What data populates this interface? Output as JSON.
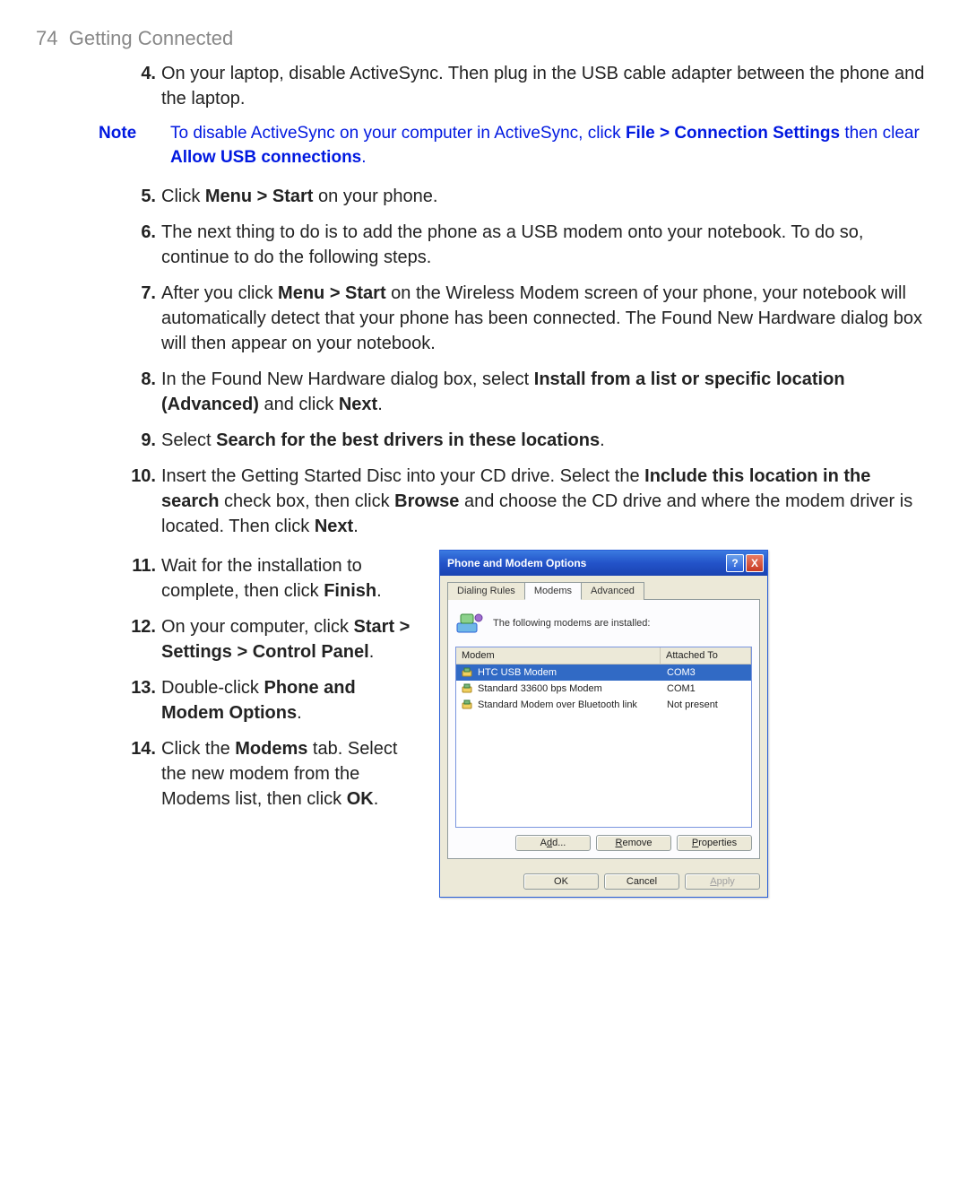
{
  "header": {
    "page_number": "74",
    "title": "Getting Connected"
  },
  "steps": {
    "s4": {
      "num": "4.",
      "text_a": "On your laptop, disable ActiveSync. Then plug in the USB cable adapter between the phone and the laptop."
    },
    "s5": {
      "num": "5.",
      "text_a": "Click ",
      "bold_a": "Menu > Start",
      "text_b": " on your phone."
    },
    "s6": {
      "num": "6.",
      "text_a": "The next thing to do is to add the phone as a USB modem onto your notebook. To do so, continue to do the following steps."
    },
    "s7": {
      "num": "7.",
      "text_a": "After you click ",
      "bold_a": "Menu > Start",
      "text_b": " on the Wireless Modem screen of your phone, your notebook will automatically detect that your phone has been connected. The Found New Hardware dialog box will then appear on your notebook."
    },
    "s8": {
      "num": "8.",
      "text_a": "In the Found New Hardware dialog box, select ",
      "bold_a": "Install from a list or specific location (Advanced)",
      "text_b": " and click ",
      "bold_b": "Next",
      "text_c": "."
    },
    "s9": {
      "num": "9.",
      "text_a": "Select ",
      "bold_a": "Search for the best drivers in these locations",
      "text_b": "."
    },
    "s10": {
      "num": "10.",
      "text_a": "Insert the Getting Started Disc into your CD drive. Select the ",
      "bold_a": "Include this location in the search",
      "text_b": " check box, then click ",
      "bold_b": "Browse",
      "text_c": " and choose the CD drive and where the modem driver is located. Then click ",
      "bold_c": "Next",
      "text_d": "."
    },
    "s11": {
      "num": "11.",
      "text_a": "Wait for the installation to complete, then click ",
      "bold_a": "Finish",
      "text_b": "."
    },
    "s12": {
      "num": "12.",
      "text_a": "On your computer, click ",
      "bold_a": "Start > Settings > Control Panel",
      "text_b": "."
    },
    "s13": {
      "num": "13.",
      "text_a": "Double-click ",
      "bold_a": "Phone and Modem Options",
      "text_b": "."
    },
    "s14": {
      "num": "14.",
      "text_a": "Click the ",
      "bold_a": "Modems",
      "text_b": " tab. Select the new modem from the Modems list, then click ",
      "bold_b": "OK",
      "text_c": "."
    }
  },
  "note": {
    "label": "Note",
    "text_a": "To disable ActiveSync on your computer in ActiveSync, click ",
    "bold_a": "File > Connection Settings",
    "text_b": " then clear ",
    "bold_b": "Allow USB connections",
    "text_c": "."
  },
  "dialog": {
    "title": "Phone and Modem Options",
    "help": "?",
    "close": "X",
    "tabs": {
      "t1": "Dialing Rules",
      "t2": "Modems",
      "t3": "Advanced"
    },
    "desc": "The following modems are installed:",
    "headers": {
      "modem": "Modem",
      "port": "Attached To"
    },
    "rows": [
      {
        "name": "HTC USB Modem",
        "port": "COM3",
        "selected": true
      },
      {
        "name": "Standard 33600 bps Modem",
        "port": "COM1",
        "selected": false
      },
      {
        "name": "Standard Modem over Bluetooth link",
        "port": "Not present",
        "selected": false
      }
    ],
    "buttons": {
      "add_pre": "A",
      "add_ul": "d",
      "add_post": "d...",
      "remove_ul": "R",
      "remove_post": "emove",
      "props_ul": "P",
      "props_post": "roperties",
      "ok": "OK",
      "cancel": "Cancel",
      "apply_ul": "A",
      "apply_post": "pply"
    }
  }
}
